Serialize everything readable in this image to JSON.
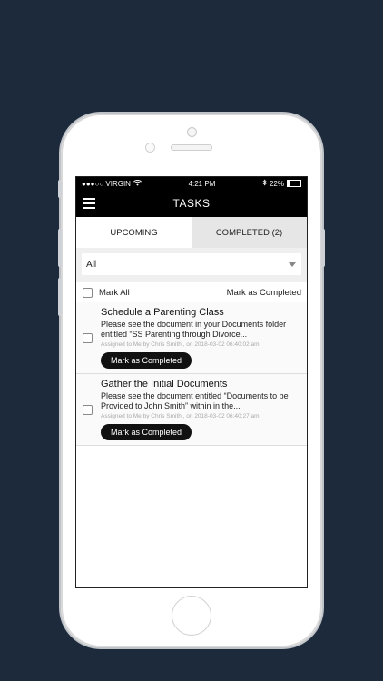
{
  "status_bar": {
    "carrier": "●●●○○ VIRGIN",
    "wifi_icon": "wifi-icon",
    "time": "4:21 PM",
    "bluetooth_icon": "bluetooth-icon",
    "battery_percent": "22%",
    "battery_level": 0.22
  },
  "nav": {
    "title": "TASKS",
    "menu_icon": "hamburger-menu-icon"
  },
  "tabs": [
    {
      "label": "UPCOMING",
      "active": true
    },
    {
      "label": "COMPLETED (2)",
      "active": false
    }
  ],
  "filter": {
    "selected": "All"
  },
  "mark_all": {
    "label": "Mark All",
    "action": "Mark as Completed"
  },
  "tasks": [
    {
      "title": "Schedule a Parenting Class",
      "description": "Please see the document in your Documents folder entitled “SS Parenting through Divorce...",
      "meta": "Assigned to Me by Chris Smith , on 2018-03-02 06:40:02 am",
      "button": "Mark as Completed"
    },
    {
      "title": "Gather the Initial Documents",
      "description": "Please see the document entitled “Documents to be Provided to John Smith” within in the...",
      "meta": "Assigned to Me by Chris Smith , on 2018-03-02 06:40:27 am",
      "button": "Mark as Completed"
    }
  ],
  "colors": {
    "background": "#1c2a3c",
    "header": "#000000",
    "button": "#111111"
  }
}
